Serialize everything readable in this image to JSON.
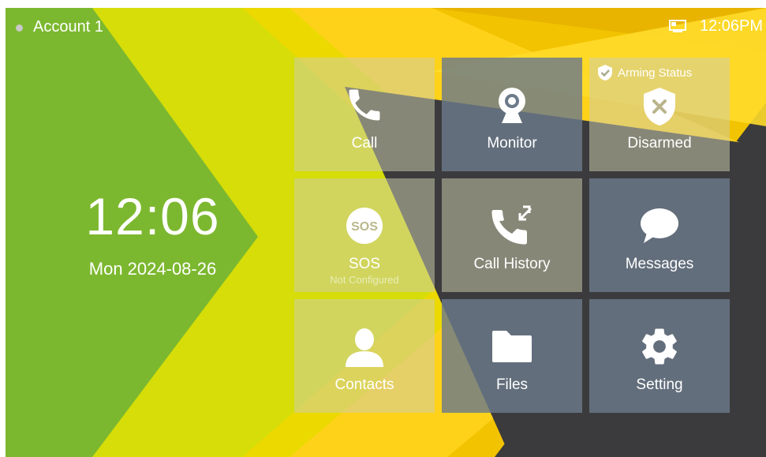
{
  "status_bar": {
    "account": "Account 1",
    "time": "12:06PM"
  },
  "clock": {
    "time": "12:06",
    "date": "Mon 2024-08-26"
  },
  "tiles": [
    {
      "label": "Call",
      "icon": "phone-icon"
    },
    {
      "label": "Monitor",
      "icon": "webcam-icon"
    },
    {
      "label": "Disarmed",
      "icon": "shield-x-icon",
      "tag": "Arming Status"
    },
    {
      "label": "SOS",
      "icon": "sos-icon",
      "sublabel": "Not Configured"
    },
    {
      "label": "Call History",
      "icon": "call-history-icon"
    },
    {
      "label": "Messages",
      "icon": "chat-bubble-icon"
    },
    {
      "label": "Contacts",
      "icon": "person-icon"
    },
    {
      "label": "Files",
      "icon": "folder-icon"
    },
    {
      "label": "Setting",
      "icon": "gear-icon"
    }
  ],
  "colors": {
    "green": "#7cb82f",
    "yellow": "#f2c300",
    "lime": "#d6dd08",
    "dark": "#3b3b3d",
    "tile_dark": "#6c7a8a"
  }
}
